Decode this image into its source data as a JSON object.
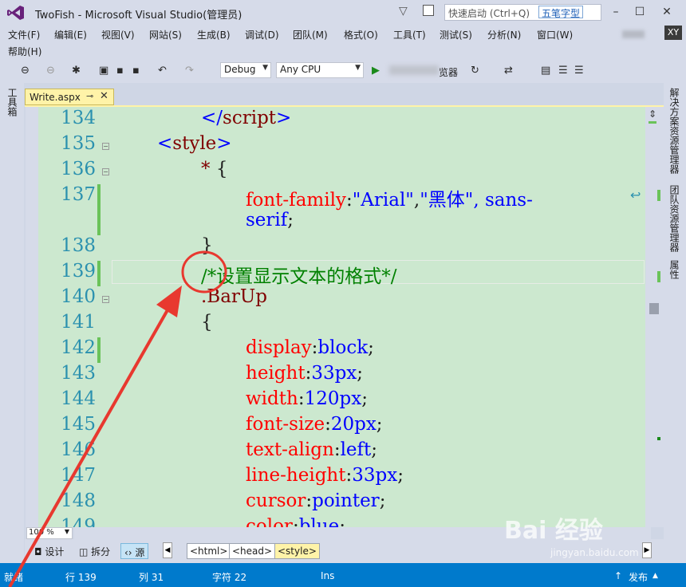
{
  "window": {
    "title": "TwoFish - Microsoft Visual Studio(管理员)",
    "quick_launch_placeholder": "快速启动 (Ctrl+Q)",
    "ime_badge": "五笔字型",
    "account_initials": "XY"
  },
  "menu": [
    "文件(F)",
    "编辑(E)",
    "视图(V)",
    "网站(S)",
    "生成(B)",
    "调试(D)",
    "团队(M)",
    "格式(O)",
    "工具(T)",
    "测试(S)",
    "分析(N)",
    "窗口(W)",
    "帮助(H)"
  ],
  "toolbar": {
    "config": "Debug",
    "platform": "Any CPU",
    "run_label": "览器"
  },
  "side_panels": {
    "left": "工具箱",
    "right": [
      "解决方案资源管理器",
      "团队资源管理器",
      "属性"
    ]
  },
  "tab": {
    "label": "Write.aspx"
  },
  "editor": {
    "lines": [
      {
        "num": "134",
        "parts": [
          [
            "br",
            "</"
          ],
          [
            "kw",
            "script"
          ],
          [
            "br",
            ">"
          ]
        ]
      },
      {
        "num": "135",
        "parts": [
          [
            "br",
            "<"
          ],
          [
            "kw",
            "style"
          ],
          [
            "br",
            ">"
          ]
        ]
      },
      {
        "num": "136",
        "parts": [
          [
            "sel",
            "* "
          ],
          [
            "pn",
            "{"
          ]
        ]
      },
      {
        "num": "137",
        "parts": [
          [
            "prop",
            "font-family"
          ],
          [
            "pn",
            ":"
          ],
          [
            "val",
            "\"Arial\""
          ],
          [
            "pn",
            ","
          ],
          [
            "val",
            "\"黑体\", sans-"
          ]
        ]
      },
      {
        "num": "",
        "parts": [
          [
            "val",
            "serif"
          ],
          [
            "pn",
            ";"
          ]
        ]
      },
      {
        "num": "138",
        "parts": [
          [
            "pn",
            "}"
          ]
        ]
      },
      {
        "num": "139",
        "parts": [
          [
            "cm",
            "/*设置显示文本的格式*/"
          ]
        ]
      },
      {
        "num": "140",
        "parts": [
          [
            "sel",
            ".BarUp"
          ]
        ]
      },
      {
        "num": "141",
        "parts": [
          [
            "pn",
            "{"
          ]
        ]
      },
      {
        "num": "142",
        "parts": [
          [
            "prop",
            "display"
          ],
          [
            "pn",
            ":"
          ],
          [
            "val",
            "block"
          ],
          [
            "pn",
            ";"
          ]
        ]
      },
      {
        "num": "143",
        "parts": [
          [
            "prop",
            "height"
          ],
          [
            "pn",
            ":"
          ],
          [
            "val",
            "33px"
          ],
          [
            "pn",
            ";"
          ]
        ]
      },
      {
        "num": "144",
        "parts": [
          [
            "prop",
            "width"
          ],
          [
            "pn",
            ":"
          ],
          [
            "val",
            "120px"
          ],
          [
            "pn",
            ";"
          ]
        ]
      },
      {
        "num": "145",
        "parts": [
          [
            "prop",
            "font-size"
          ],
          [
            "pn",
            ":"
          ],
          [
            "val",
            "20px"
          ],
          [
            "pn",
            ";"
          ]
        ]
      },
      {
        "num": "146",
        "parts": [
          [
            "prop",
            "text-align"
          ],
          [
            "pn",
            ":"
          ],
          [
            "val",
            "left"
          ],
          [
            "pn",
            ";"
          ]
        ]
      },
      {
        "num": "147",
        "parts": [
          [
            "prop",
            "line-height"
          ],
          [
            "pn",
            ":"
          ],
          [
            "val",
            "33px"
          ],
          [
            "pn",
            ";"
          ]
        ]
      },
      {
        "num": "148",
        "parts": [
          [
            "prop",
            "cursor"
          ],
          [
            "pn",
            ":"
          ],
          [
            "val",
            "pointer"
          ],
          [
            "pn",
            ";"
          ]
        ]
      },
      {
        "num": "149",
        "parts": [
          [
            "prop",
            "color"
          ],
          [
            "pn",
            ":"
          ],
          [
            "val",
            "blue"
          ],
          [
            "pn",
            ";"
          ]
        ]
      }
    ]
  },
  "zoom": "100 %",
  "views": {
    "design": "设计",
    "split": "拆分",
    "source": "源"
  },
  "breadcrumbs": [
    "<html>",
    "<head>",
    "<style>"
  ],
  "status": {
    "state": "就绪",
    "line": "行 139",
    "col": "列 31",
    "char": "字符 22",
    "mode": "Ins",
    "publish": "发布"
  },
  "watermark": {
    "text": "Bai 经验",
    "url": "jingyan.baidu.com"
  },
  "colors": {
    "status_bar": "#007acc",
    "editor_bg": "#cce8cf",
    "annotation": "#e8382f"
  }
}
